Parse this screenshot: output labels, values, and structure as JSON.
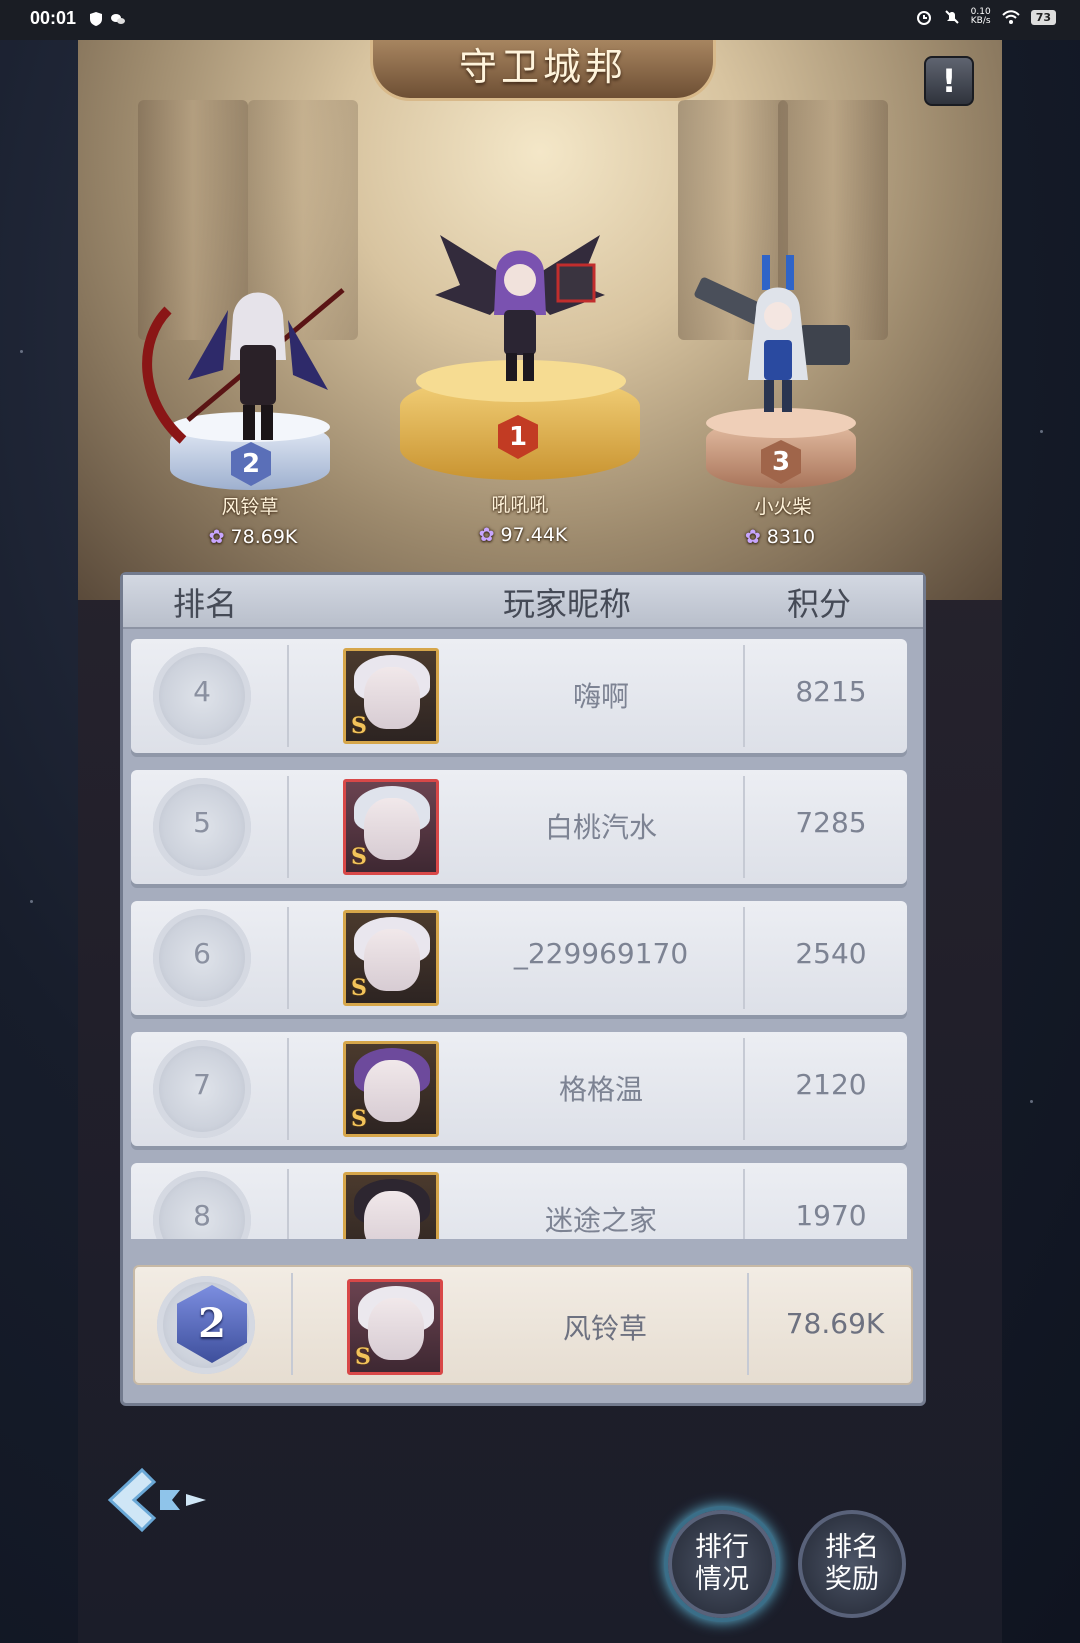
{
  "statusbar": {
    "time": "00:01",
    "net_speed_value": "0.10",
    "net_speed_unit": "KB/s",
    "battery": "73"
  },
  "title": "守卫城邦",
  "info_label": "!",
  "podium": [
    {
      "rank": "2",
      "name": "风铃草",
      "score": "78.69K"
    },
    {
      "rank": "1",
      "name": "吼吼吼",
      "score": "97.44K"
    },
    {
      "rank": "3",
      "name": "小火柴",
      "score": "8310"
    }
  ],
  "table": {
    "headers": {
      "rank": "排名",
      "nickname": "玩家昵称",
      "score": "积分"
    },
    "rows": [
      {
        "rank": "4",
        "name": "嗨啊",
        "score": "8215"
      },
      {
        "rank": "5",
        "name": "白桃汽水",
        "score": "7285"
      },
      {
        "rank": "6",
        "name": "_229969170",
        "score": "2540"
      },
      {
        "rank": "7",
        "name": "格格温",
        "score": "2120"
      },
      {
        "rank": "8",
        "name": "迷途之家",
        "score": "1970"
      }
    ]
  },
  "self": {
    "rank": "2",
    "name": "风铃草",
    "score": "78.69K"
  },
  "buttons": {
    "ranking_status": [
      "排行",
      "情况"
    ],
    "ranking_rewards": [
      "排名",
      "奖励"
    ]
  },
  "colors": {
    "gold": "#d6a64a",
    "silver": "#8fa2d8",
    "bronze": "#b98569",
    "accent": "#5fb6d6"
  }
}
